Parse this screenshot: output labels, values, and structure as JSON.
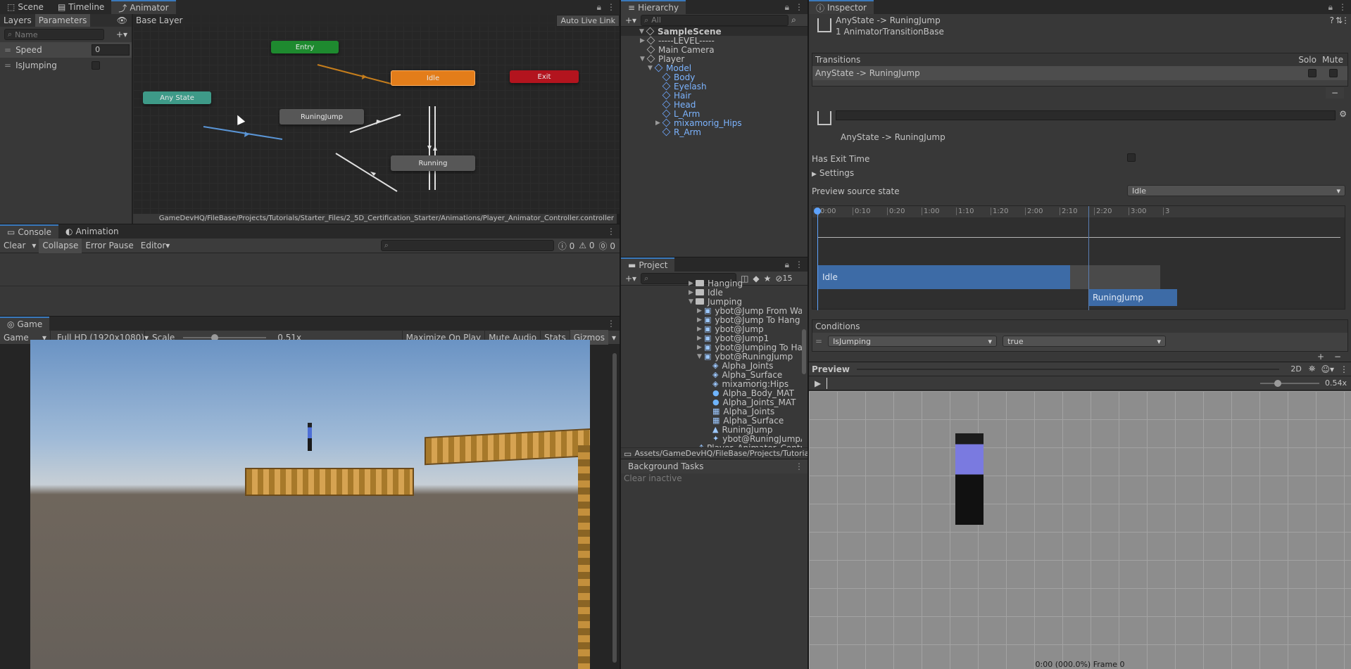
{
  "animator": {
    "tabs": [
      {
        "label": "Scene",
        "icon": "scene-icon"
      },
      {
        "label": "Timeline",
        "icon": "timeline-icon"
      },
      {
        "label": "Animator",
        "icon": "animator-icon"
      }
    ],
    "left_tabs": [
      "Layers",
      "Parameters"
    ],
    "name_placeholder": "Name",
    "params": [
      {
        "name": "Speed",
        "value": "0"
      },
      {
        "name": "IsJumping",
        "value": ""
      }
    ],
    "breadcrumb": "Base Layer",
    "auto_live_link": "Auto Live Link",
    "nodes": {
      "entry": "Entry",
      "idle": "Idle",
      "exit": "Exit",
      "any": "Any State",
      "jump": "RuningJump",
      "running": "Running"
    },
    "path": "GameDevHQ/FileBase/Projects/Tutorials/Starter_Files/2_5D_Certification_Starter/Animations/Player_Animator_Controller.controller"
  },
  "console": {
    "tabs": [
      "Console",
      "Animation"
    ],
    "clear": "Clear",
    "collapse": "Collapse",
    "error_pause": "Error Pause",
    "editor": "Editor",
    "counts": [
      "0",
      "0",
      "0"
    ]
  },
  "game": {
    "tab": "Game",
    "display": "Game",
    "resolution": "Full HD (1920x1080)",
    "scale_label": "Scale",
    "scale_value": "0.51x",
    "maximize": "Maximize On Play",
    "mute": "Mute Audio",
    "stats": "Stats",
    "gizmos": "Gizmos"
  },
  "hierarchy": {
    "tab": "Hierarchy",
    "search": "All",
    "items": [
      {
        "label": "SampleScene",
        "depth": 0,
        "kind": "scene",
        "exp": "▼"
      },
      {
        "label": "-----LEVEL-----",
        "depth": 1,
        "kind": "cube",
        "exp": "▶"
      },
      {
        "label": "Main Camera",
        "depth": 1,
        "kind": "cube",
        "exp": ""
      },
      {
        "label": "Player",
        "depth": 1,
        "kind": "cube",
        "exp": "▼"
      },
      {
        "label": "Model",
        "depth": 2,
        "kind": "prefab",
        "exp": "▼"
      },
      {
        "label": "Body",
        "depth": 3,
        "kind": "prefab",
        "exp": ""
      },
      {
        "label": "Eyelash",
        "depth": 3,
        "kind": "prefab",
        "exp": ""
      },
      {
        "label": "Hair",
        "depth": 3,
        "kind": "prefab",
        "exp": ""
      },
      {
        "label": "Head",
        "depth": 3,
        "kind": "prefab",
        "exp": ""
      },
      {
        "label": "L_Arm",
        "depth": 3,
        "kind": "prefab",
        "exp": ""
      },
      {
        "label": "mixamorig_Hips",
        "depth": 3,
        "kind": "prefab",
        "exp": "▶"
      },
      {
        "label": "R_Arm",
        "depth": 3,
        "kind": "prefab",
        "exp": ""
      }
    ]
  },
  "project": {
    "tab": "Project",
    "hidden_count": "15",
    "items": [
      {
        "label": "Hanging",
        "depth": 0,
        "kind": "folder",
        "exp": "▶"
      },
      {
        "label": "Idle",
        "depth": 0,
        "kind": "folder",
        "exp": "▶"
      },
      {
        "label": "Jumping",
        "depth": 0,
        "kind": "folder-open",
        "exp": "▼"
      },
      {
        "label": "ybot@Jump From Wall",
        "depth": 1,
        "kind": "model",
        "exp": "▶"
      },
      {
        "label": "ybot@Jump To Hang",
        "depth": 1,
        "kind": "model",
        "exp": "▶"
      },
      {
        "label": "ybot@Jump",
        "depth": 1,
        "kind": "model",
        "exp": "▶"
      },
      {
        "label": "ybot@Jump1",
        "depth": 1,
        "kind": "model",
        "exp": "▶"
      },
      {
        "label": "ybot@Jumping To Hanging",
        "depth": 1,
        "kind": "model",
        "exp": "▶"
      },
      {
        "label": "ybot@RuningJump",
        "depth": 1,
        "kind": "model",
        "exp": "▼"
      },
      {
        "label": "Alpha_Joints",
        "depth": 2,
        "kind": "cube",
        "exp": ""
      },
      {
        "label": "Alpha_Surface",
        "depth": 2,
        "kind": "cube",
        "exp": ""
      },
      {
        "label": "mixamorig:Hips",
        "depth": 2,
        "kind": "cube",
        "exp": ""
      },
      {
        "label": "Alpha_Body_MAT",
        "depth": 2,
        "kind": "material",
        "exp": ""
      },
      {
        "label": "Alpha_Joints_MAT",
        "depth": 2,
        "kind": "material",
        "exp": ""
      },
      {
        "label": "Alpha_Joints",
        "depth": 2,
        "kind": "mesh",
        "exp": ""
      },
      {
        "label": "Alpha_Surface",
        "depth": 2,
        "kind": "mesh",
        "exp": ""
      },
      {
        "label": "RuningJump",
        "depth": 2,
        "kind": "anim",
        "exp": ""
      },
      {
        "label": "ybot@RuningJumpAvatar",
        "depth": 2,
        "kind": "avatar",
        "exp": ""
      },
      {
        "label": "Player_Animator_Controller",
        "depth": 0,
        "kind": "controller",
        "exp": ""
      }
    ],
    "path": "Assets/GameDevHQ/FileBase/Projects/Tutorials/Start"
  },
  "background": {
    "tab": "Background Tasks",
    "clear": "Clear inactive"
  },
  "inspector": {
    "tab": "Inspector",
    "title": "AnyState -> RuningJump",
    "subtitle": "1 AnimatorTransitionBase",
    "transitions_label": "Transitions",
    "solo": "Solo",
    "mute": "Mute",
    "transition_item": "AnyState -> RuningJump",
    "transition_name": "AnyState -> RuningJump",
    "has_exit_time": "Has Exit Time",
    "settings": "Settings",
    "preview_source_label": "Preview source state",
    "preview_source_value": "Idle",
    "timeline_ticks": [
      "0:00",
      "0:10",
      "0:20",
      "1:00",
      "1:10",
      "1:20",
      "2:00",
      "2:10",
      "2:20",
      "3:00",
      "3"
    ],
    "track_a": "Idle",
    "track_b": "RuningJump",
    "conditions_label": "Conditions",
    "cond_param": "IsJumping",
    "cond_value": "true"
  },
  "preview": {
    "label": "Preview",
    "mode": "2D",
    "speed": "0.54x",
    "footer": "0:00 (000.0%) Frame 0"
  }
}
